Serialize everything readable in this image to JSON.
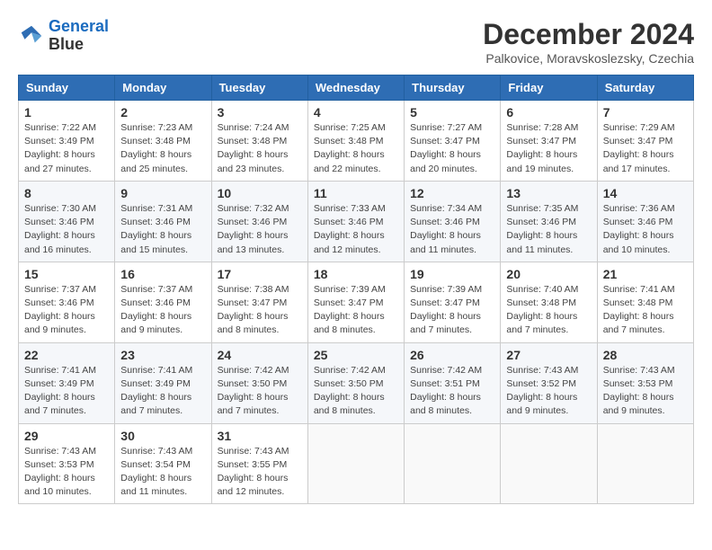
{
  "logo": {
    "line1": "General",
    "line2": "Blue"
  },
  "title": "December 2024",
  "location": "Palkovice, Moravskoslezsky, Czechia",
  "days_header": [
    "Sunday",
    "Monday",
    "Tuesday",
    "Wednesday",
    "Thursday",
    "Friday",
    "Saturday"
  ],
  "weeks": [
    [
      {
        "day": "1",
        "sunrise": "7:22 AM",
        "sunset": "3:49 PM",
        "daylight": "8 hours and 27 minutes."
      },
      {
        "day": "2",
        "sunrise": "7:23 AM",
        "sunset": "3:48 PM",
        "daylight": "8 hours and 25 minutes."
      },
      {
        "day": "3",
        "sunrise": "7:24 AM",
        "sunset": "3:48 PM",
        "daylight": "8 hours and 23 minutes."
      },
      {
        "day": "4",
        "sunrise": "7:25 AM",
        "sunset": "3:48 PM",
        "daylight": "8 hours and 22 minutes."
      },
      {
        "day": "5",
        "sunrise": "7:27 AM",
        "sunset": "3:47 PM",
        "daylight": "8 hours and 20 minutes."
      },
      {
        "day": "6",
        "sunrise": "7:28 AM",
        "sunset": "3:47 PM",
        "daylight": "8 hours and 19 minutes."
      },
      {
        "day": "7",
        "sunrise": "7:29 AM",
        "sunset": "3:47 PM",
        "daylight": "8 hours and 17 minutes."
      }
    ],
    [
      {
        "day": "8",
        "sunrise": "7:30 AM",
        "sunset": "3:46 PM",
        "daylight": "8 hours and 16 minutes."
      },
      {
        "day": "9",
        "sunrise": "7:31 AM",
        "sunset": "3:46 PM",
        "daylight": "8 hours and 15 minutes."
      },
      {
        "day": "10",
        "sunrise": "7:32 AM",
        "sunset": "3:46 PM",
        "daylight": "8 hours and 13 minutes."
      },
      {
        "day": "11",
        "sunrise": "7:33 AM",
        "sunset": "3:46 PM",
        "daylight": "8 hours and 12 minutes."
      },
      {
        "day": "12",
        "sunrise": "7:34 AM",
        "sunset": "3:46 PM",
        "daylight": "8 hours and 11 minutes."
      },
      {
        "day": "13",
        "sunrise": "7:35 AM",
        "sunset": "3:46 PM",
        "daylight": "8 hours and 11 minutes."
      },
      {
        "day": "14",
        "sunrise": "7:36 AM",
        "sunset": "3:46 PM",
        "daylight": "8 hours and 10 minutes."
      }
    ],
    [
      {
        "day": "15",
        "sunrise": "7:37 AM",
        "sunset": "3:46 PM",
        "daylight": "8 hours and 9 minutes."
      },
      {
        "day": "16",
        "sunrise": "7:37 AM",
        "sunset": "3:46 PM",
        "daylight": "8 hours and 9 minutes."
      },
      {
        "day": "17",
        "sunrise": "7:38 AM",
        "sunset": "3:47 PM",
        "daylight": "8 hours and 8 minutes."
      },
      {
        "day": "18",
        "sunrise": "7:39 AM",
        "sunset": "3:47 PM",
        "daylight": "8 hours and 8 minutes."
      },
      {
        "day": "19",
        "sunrise": "7:39 AM",
        "sunset": "3:47 PM",
        "daylight": "8 hours and 7 minutes."
      },
      {
        "day": "20",
        "sunrise": "7:40 AM",
        "sunset": "3:48 PM",
        "daylight": "8 hours and 7 minutes."
      },
      {
        "day": "21",
        "sunrise": "7:41 AM",
        "sunset": "3:48 PM",
        "daylight": "8 hours and 7 minutes."
      }
    ],
    [
      {
        "day": "22",
        "sunrise": "7:41 AM",
        "sunset": "3:49 PM",
        "daylight": "8 hours and 7 minutes."
      },
      {
        "day": "23",
        "sunrise": "7:41 AM",
        "sunset": "3:49 PM",
        "daylight": "8 hours and 7 minutes."
      },
      {
        "day": "24",
        "sunrise": "7:42 AM",
        "sunset": "3:50 PM",
        "daylight": "8 hours and 7 minutes."
      },
      {
        "day": "25",
        "sunrise": "7:42 AM",
        "sunset": "3:50 PM",
        "daylight": "8 hours and 8 minutes."
      },
      {
        "day": "26",
        "sunrise": "7:42 AM",
        "sunset": "3:51 PM",
        "daylight": "8 hours and 8 minutes."
      },
      {
        "day": "27",
        "sunrise": "7:43 AM",
        "sunset": "3:52 PM",
        "daylight": "8 hours and 9 minutes."
      },
      {
        "day": "28",
        "sunrise": "7:43 AM",
        "sunset": "3:53 PM",
        "daylight": "8 hours and 9 minutes."
      }
    ],
    [
      {
        "day": "29",
        "sunrise": "7:43 AM",
        "sunset": "3:53 PM",
        "daylight": "8 hours and 10 minutes."
      },
      {
        "day": "30",
        "sunrise": "7:43 AM",
        "sunset": "3:54 PM",
        "daylight": "8 hours and 11 minutes."
      },
      {
        "day": "31",
        "sunrise": "7:43 AM",
        "sunset": "3:55 PM",
        "daylight": "8 hours and 12 minutes."
      },
      null,
      null,
      null,
      null
    ]
  ]
}
